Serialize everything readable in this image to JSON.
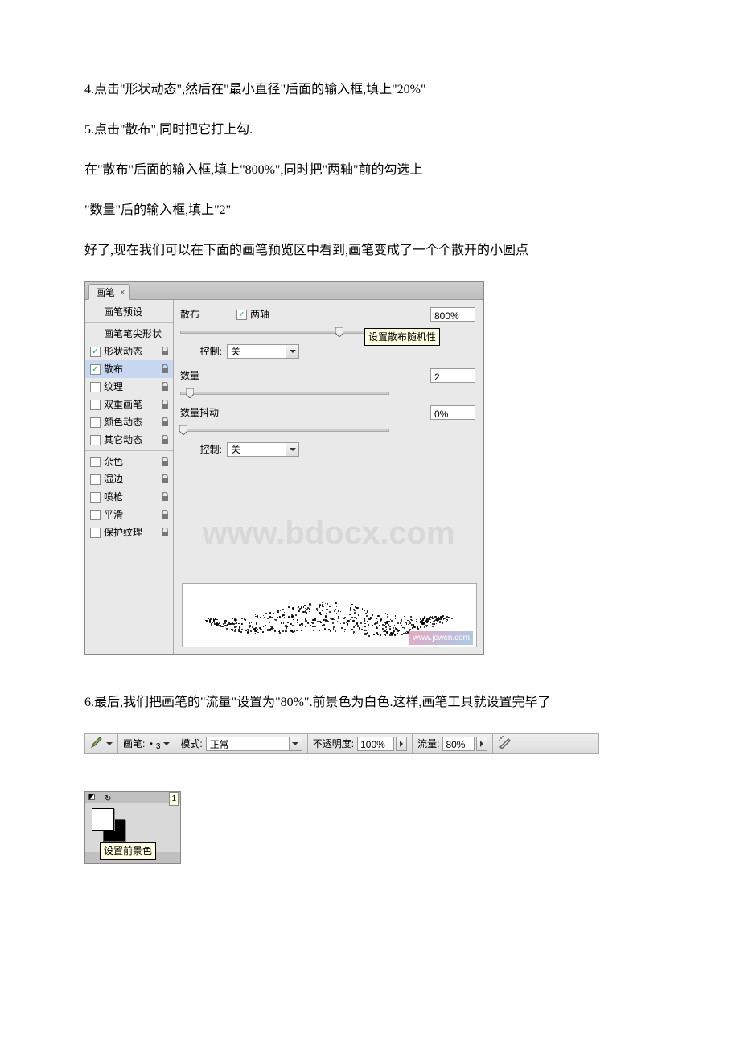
{
  "paragraphs": {
    "p1": "4.点击\"形状动态\",然后在\"最小直径\"后面的输入框,填上\"20%\"",
    "p2": "5.点击\"散布\",同时把它打上勾.",
    "p3": "在\"散布\"后面的输入框,填上\"800%\",同时把\"两轴\"前的勾选上",
    "p4": "\"数量\"后的输入框,填上\"2\"",
    "p5": "好了,现在我们可以在下面的画笔预览区中看到,画笔变成了一个个散开的小圆点",
    "p6": "6.最后,我们把画笔的\"流量\"设置为\"80%\".前景色为白色.这样,画笔工具就设置完毕了"
  },
  "panel": {
    "tab": "画笔",
    "close": "×",
    "sidebar": [
      {
        "checked": null,
        "label": "画笔预设",
        "lock": false
      },
      {
        "checked": null,
        "label": "画笔笔尖形状",
        "lock": false
      },
      {
        "checked": true,
        "label": "形状动态",
        "lock": true
      },
      {
        "checked": true,
        "label": "散布",
        "lock": true,
        "selected": true
      },
      {
        "checked": false,
        "label": "纹理",
        "lock": true
      },
      {
        "checked": false,
        "label": "双重画笔",
        "lock": true
      },
      {
        "checked": false,
        "label": "颜色动态",
        "lock": true
      },
      {
        "checked": false,
        "label": "其它动态",
        "lock": true
      },
      {
        "checked": false,
        "label": "杂色",
        "lock": true
      },
      {
        "checked": false,
        "label": "湿边",
        "lock": true
      },
      {
        "checked": false,
        "label": "喷枪",
        "lock": true
      },
      {
        "checked": false,
        "label": "平滑",
        "lock": true
      },
      {
        "checked": false,
        "label": "保护纹理",
        "lock": true
      }
    ],
    "main": {
      "scatter_label": "散布",
      "both_axes_label": "两轴",
      "scatter_value": "800%",
      "tooltip": "设置散布随机性",
      "control_label": "控制:",
      "control_value": "关",
      "count_label": "数量",
      "count_value": "2",
      "jitter_label": "数量抖动",
      "jitter_value": "0%"
    },
    "watermark": "www.bdocx.com",
    "preview_watermark": "www.jcwcn.com"
  },
  "toolbar": {
    "brush_label": "画笔:",
    "brush_size": "3",
    "mode_label": "模式:",
    "mode_value": "正常",
    "opacity_label": "不透明度:",
    "opacity_value": "100%",
    "flow_label": "流量:",
    "flow_value": "80%"
  },
  "swatch": {
    "num": "1",
    "tooltip": "设置前景色"
  }
}
